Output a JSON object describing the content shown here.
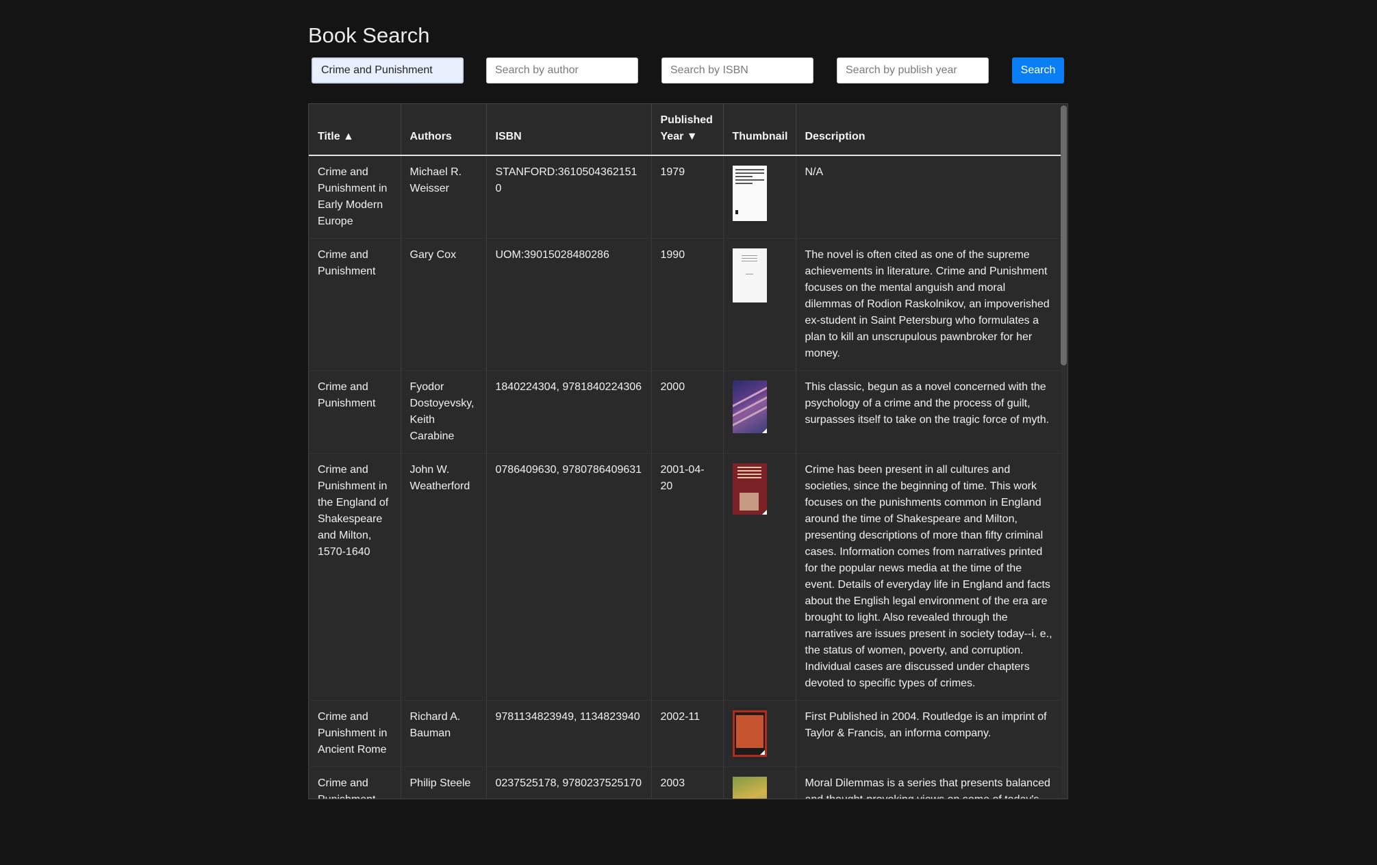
{
  "page": {
    "title": "Book Search"
  },
  "search": {
    "title_value": "Crime and Punishment",
    "author_placeholder": "Search by author",
    "isbn_placeholder": "Search by ISBN",
    "year_placeholder": "Search by publish year",
    "button_label": "Search"
  },
  "table": {
    "headers": {
      "title": "Title ▲",
      "authors": "Authors",
      "isbn": "ISBN",
      "year_line1": "Published",
      "year_line2": "Year ▼",
      "thumbnail": "Thumbnail",
      "description": "Description"
    },
    "rows": [
      {
        "title": "Crime and Punishment in Early Modern Europe",
        "authors": "Michael R. Weisser",
        "isbn": "STANFORD:36105043621510",
        "year": "1979",
        "thumbnail": "book-cover-image",
        "description": "N/A"
      },
      {
        "title": "Crime and Punishment",
        "authors": "Gary Cox",
        "isbn": "UOM:39015028480286",
        "year": "1990",
        "thumbnail": "book-cover-image",
        "description": "The novel is often cited as one of the supreme achievements in literature. Crime and Punishment focuses on the mental anguish and moral dilemmas of Rodion Raskolnikov, an impoverished ex-student in Saint Petersburg who formulates a plan to kill an unscrupulous pawnbroker for her money."
      },
      {
        "title": "Crime and Punishment",
        "authors": "Fyodor Dostoyevsky, Keith Carabine",
        "isbn": "1840224304, 9781840224306",
        "year": "2000",
        "thumbnail": "book-cover-image",
        "description": "This classic, begun as a novel concerned with the psychology of a crime and the process of guilt, surpasses itself to take on the tragic force of myth."
      },
      {
        "title": "Crime and Punishment in the England of Shakespeare and Milton, 1570-1640",
        "authors": "John W. Weatherford",
        "isbn": "0786409630, 9780786409631",
        "year": "2001-04-20",
        "thumbnail": "book-cover-image",
        "description": "Crime has been present in all cultures and societies, since the beginning of time. This work focuses on the punishments common in England around the time of Shakespeare and Milton, presenting descriptions of more than fifty criminal cases. Information comes from narratives printed for the popular news media at the time of the event. Details of everyday life in England and facts about the English legal environment of the era are brought to light. Also revealed through the narratives are issues present in society today--i. e., the status of women, poverty, and corruption. Individual cases are discussed under chapters devoted to specific types of crimes."
      },
      {
        "title": "Crime and Punishment in Ancient Rome",
        "authors": "Richard A. Bauman",
        "isbn": "9781134823949, 1134823940",
        "year": "2002-11",
        "thumbnail": "book-cover-image",
        "description": "First Published in 2004. Routledge is an imprint of Taylor & Francis, an informa company."
      },
      {
        "title": "Crime and Punishment",
        "authors": "Philip Steele",
        "isbn": "0237525178, 9780237525170",
        "year": "2003",
        "thumbnail": "book-cover-image",
        "description": "Moral Dilemmas is a series that presents balanced and thought-provoking views on some of today's"
      }
    ]
  }
}
